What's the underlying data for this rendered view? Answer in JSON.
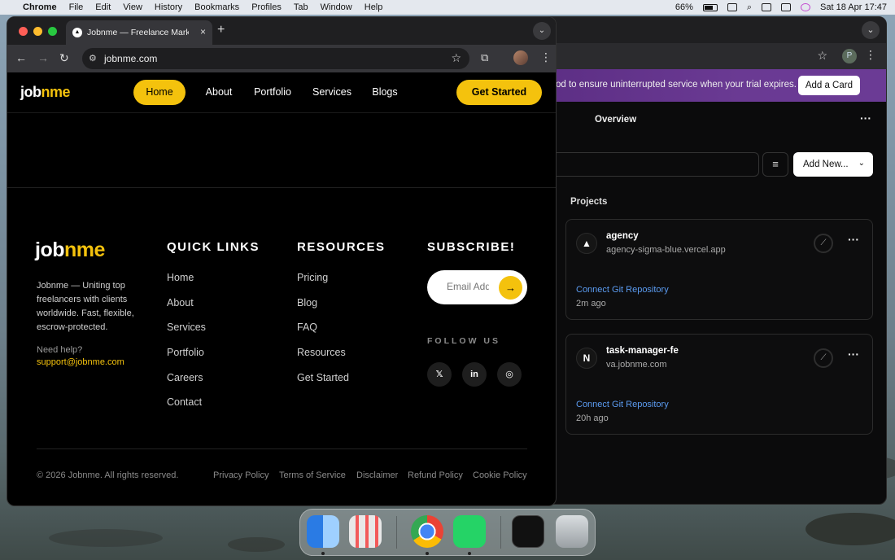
{
  "menubar": {
    "app": "Chrome",
    "items": [
      "File",
      "Edit",
      "View",
      "History",
      "Bookmarks",
      "Profiles",
      "Tab",
      "Window",
      "Help"
    ],
    "battery": "66%",
    "clock": "Sat 18 Apr  17:47"
  },
  "back_window": {
    "banner_text": "od to ensure uninterrupted service when your trial expires.",
    "add_card": "Add a Card",
    "overview": "Overview",
    "add_new": "Add New...",
    "projects_heading": "Projects",
    "profile_initial": "P",
    "projects": [
      {
        "logo": "▲",
        "name": "agency",
        "url": "agency-sigma-blue.vercel.app",
        "git": "Connect Git Repository",
        "time": "2m ago"
      },
      {
        "logo": "N",
        "name": "task-manager-fe",
        "url": "va.jobnme.com",
        "git": "Connect Git Repository",
        "time": "20h ago"
      }
    ]
  },
  "browser": {
    "tab_title": "Jobnme — Freelance Marketplace",
    "url": "jobnme.com"
  },
  "site": {
    "logo_a": "job",
    "logo_b": "nme",
    "nav": [
      "Home",
      "About",
      "Portfolio",
      "Services",
      "Blogs"
    ],
    "cta": "Get Started",
    "about": "Jobnme — Uniting top freelancers with clients worldwide. Fast, flexible, escrow-protected.",
    "need_help": "Need help?",
    "support_email": "support@jobnme.com",
    "quick_links_title": "QUICK LINKS",
    "quick_links": [
      "Home",
      "About",
      "Services",
      "Portfolio",
      "Careers",
      "Contact"
    ],
    "resources_title": "RESOURCES",
    "resources": [
      "Pricing",
      "Blog",
      "FAQ",
      "Resources",
      "Get Started"
    ],
    "subscribe_title": "SUBSCRIBE!",
    "email_placeholder": "Email Address",
    "follow_us": "FOLLOW US",
    "copyright": "© 2026 Jobnme. All rights reserved.",
    "policies": [
      "Privacy Policy",
      "Terms of Service",
      "Disclaimer",
      "Refund Policy",
      "Cookie Policy"
    ]
  },
  "colors": {
    "accent": "#f4c20d",
    "link": "#5b9bf0"
  }
}
